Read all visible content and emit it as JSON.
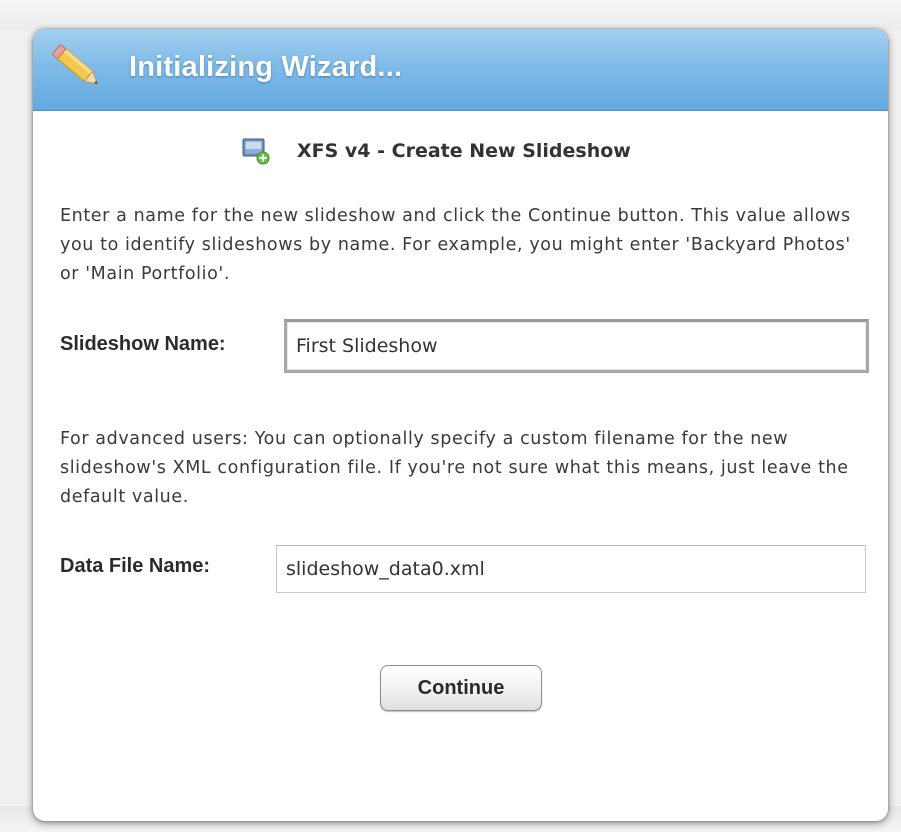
{
  "dialog": {
    "title": "Initializing Wizard...",
    "subtitle": "XFS v4 - Create New Slideshow",
    "title_icon": "pencil-icon",
    "subtitle_icon": "slideshow-add-icon"
  },
  "intro_text": "Enter a name for the new slideshow and click the Continue button. This value allows you to identify slideshows by name.  For example, you might enter 'Backyard Photos' or 'Main Portfolio'.",
  "slideshow_name": {
    "label": "Slideshow Name:",
    "value": "First Slideshow"
  },
  "advanced_text": "For advanced users: You can optionally specify a custom filename for the new slideshow's XML configuration file.  If you're not sure what this means, just leave the default value.",
  "data_file_name": {
    "label": "Data File Name:",
    "value": "slideshow_data0.xml"
  },
  "continue_label": "Continue",
  "colors": {
    "title_bar": "#7fbbe8",
    "title_text": "#ffffff",
    "body_text": "#3a3a3a"
  }
}
